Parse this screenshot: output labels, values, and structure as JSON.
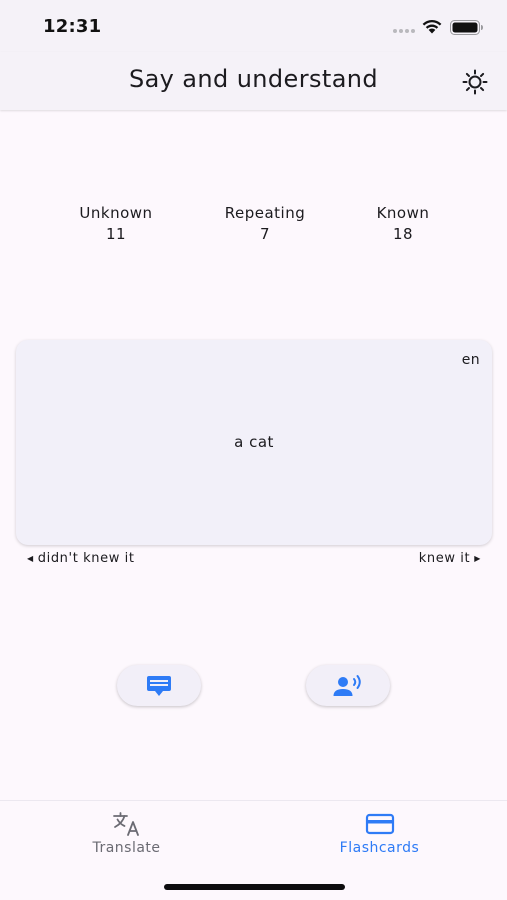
{
  "status_bar": {
    "time": "12:31"
  },
  "app_bar": {
    "title": "Say and understand",
    "theme_icon": "brightness-icon"
  },
  "stats": {
    "unknown": {
      "label": "Unknown",
      "value": "11"
    },
    "repeating": {
      "label": "Repeating",
      "value": "7"
    },
    "known": {
      "label": "Known",
      "value": "18"
    }
  },
  "card": {
    "language": "en",
    "word": "a cat"
  },
  "swipe": {
    "left_label": "didn't knew it",
    "right_label": "knew it"
  },
  "actions": {
    "subtitles_icon": "subtitles-icon",
    "voice_icon": "record-voice-icon"
  },
  "bottom_nav": {
    "items": [
      {
        "label": "Translate",
        "icon": "translate-icon",
        "active": false
      },
      {
        "label": "Flashcards",
        "icon": "card-icon",
        "active": true
      }
    ]
  },
  "colors": {
    "accent": "#2e7bf6",
    "background": "#fdf8fd",
    "card": "#f2f0f9"
  }
}
